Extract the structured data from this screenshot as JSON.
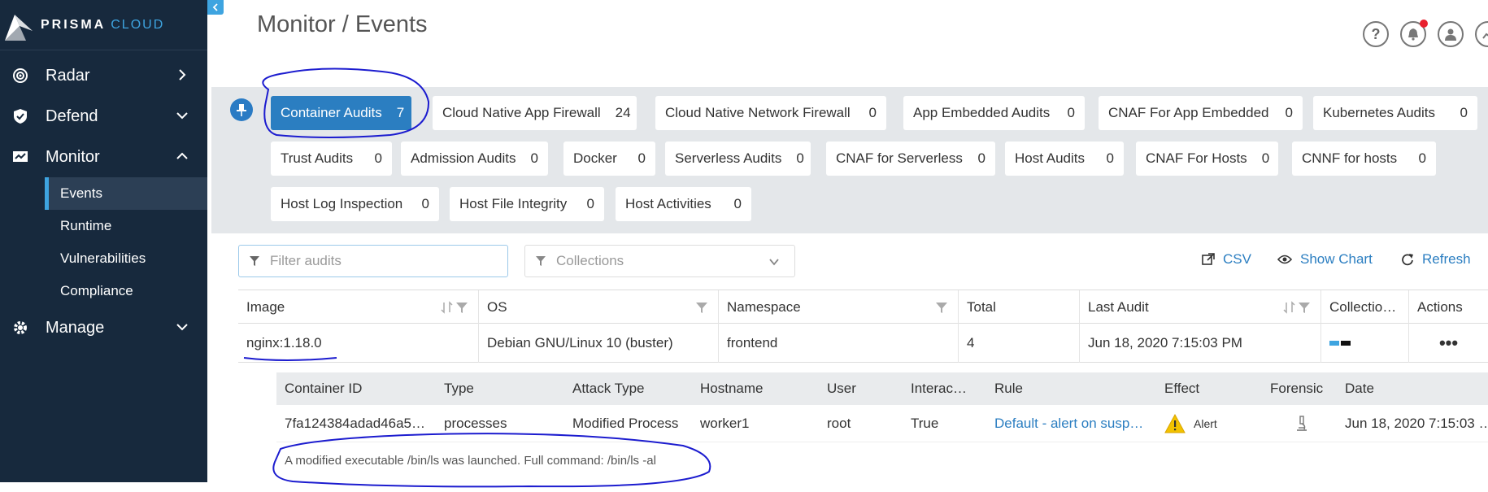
{
  "brand": {
    "name": "PRISMA",
    "product": "CLOUD"
  },
  "sidebar": {
    "items": [
      {
        "label": "Radar",
        "icon": "radar-icon",
        "chevron": "right"
      },
      {
        "label": "Defend",
        "icon": "shield-icon",
        "chevron": "down"
      },
      {
        "label": "Monitor",
        "icon": "monitor-icon",
        "chevron": "up"
      },
      {
        "label": "Manage",
        "icon": "gear-icon",
        "chevron": "down"
      }
    ],
    "monitor_sub": [
      "Events",
      "Runtime",
      "Vulnerabilities",
      "Compliance"
    ]
  },
  "header": {
    "title": "Monitor / Events",
    "help": "?"
  },
  "tabs": [
    {
      "label": "Container Audits",
      "count": "7",
      "active": true
    },
    {
      "label": "Cloud Native App Firewall",
      "count": "24"
    },
    {
      "label": "Cloud Native Network Firewall",
      "count": "0"
    },
    {
      "label": "App Embedded Audits",
      "count": "0"
    },
    {
      "label": "CNAF For App Embedded",
      "count": "0"
    },
    {
      "label": "Kubernetes Audits",
      "count": "0"
    },
    {
      "label": "Trust Audits",
      "count": "0"
    },
    {
      "label": "Admission Audits",
      "count": "0"
    },
    {
      "label": "Docker",
      "count": "0"
    },
    {
      "label": "Serverless Audits",
      "count": "0"
    },
    {
      "label": "CNAF for Serverless",
      "count": "0"
    },
    {
      "label": "Host Audits",
      "count": "0"
    },
    {
      "label": "CNAF For Hosts",
      "count": "0"
    },
    {
      "label": "CNNF for hosts",
      "count": "0"
    },
    {
      "label": "Host Log Inspection",
      "count": "0"
    },
    {
      "label": "Host File Integrity",
      "count": "0"
    },
    {
      "label": "Host Activities",
      "count": "0"
    }
  ],
  "filters": {
    "filter_placeholder": "Filter audits",
    "collections_placeholder": "Collections"
  },
  "actions": {
    "csv": "CSV",
    "show_chart": "Show Chart",
    "refresh": "Refresh"
  },
  "table": {
    "columns": [
      "Image",
      "OS",
      "Namespace",
      "Total",
      "Last Audit",
      "Collectio…",
      "Actions"
    ],
    "rows": [
      {
        "image": "nginx:1.18.0",
        "os": "Debian GNU/Linux 10 (buster)",
        "namespace": "frontend",
        "total": "4",
        "last_audit": "Jun 18, 2020 7:15:03 PM",
        "actions": "•••"
      }
    ]
  },
  "details": {
    "columns": [
      "Container ID",
      "Type",
      "Attack Type",
      "Hostname",
      "User",
      "Interac…",
      "Rule",
      "Effect",
      "Forensic",
      "Date"
    ],
    "row": {
      "container_id": "7fa124384adad46a5…",
      "type": "processes",
      "attack_type": "Modified Process",
      "hostname": "worker1",
      "user": "root",
      "interactive": "True",
      "rule": "Default - alert on susp…",
      "effect": "Alert",
      "date": "Jun 18, 2020 7:15:03 …"
    },
    "message": "A modified executable /bin/ls was launched. Full command: /bin/ls -al"
  },
  "colors": {
    "sidebar_bg": "#17293d",
    "accent": "#2b7ec1",
    "annotation": "#1c1ccf"
  }
}
